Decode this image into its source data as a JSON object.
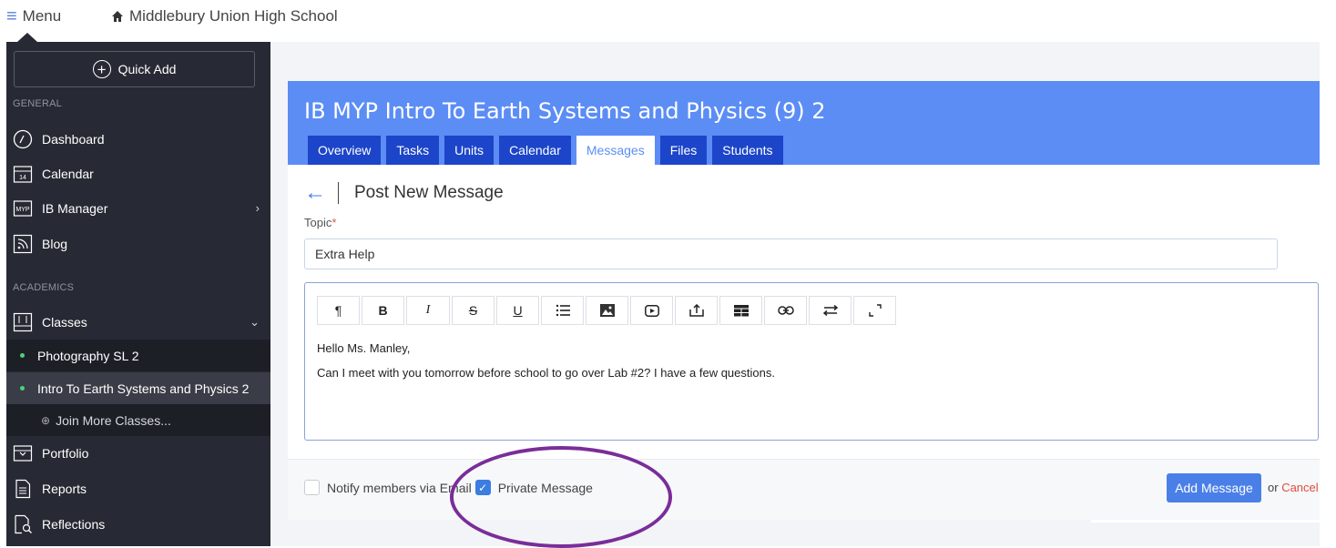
{
  "topbar": {
    "menu_label": "Menu",
    "school_name": "Middlebury Union High School"
  },
  "sidebar": {
    "quick_add_label": "Quick Add",
    "general_label": "GENERAL",
    "academics_label": "ACADEMICS",
    "items": [
      {
        "label": "Dashboard",
        "icon": "dashboard-icon"
      },
      {
        "label": "Calendar",
        "icon": "calendar-icon"
      },
      {
        "label": "IB Manager",
        "icon": "myp-icon"
      },
      {
        "label": "Blog",
        "icon": "blog-icon"
      },
      {
        "label": "Classes",
        "icon": "classes-icon"
      },
      {
        "label": "Portfolio",
        "icon": "portfolio-icon"
      },
      {
        "label": "Reports",
        "icon": "reports-icon"
      },
      {
        "label": "Reflections",
        "icon": "reflections-icon"
      }
    ],
    "calendar_icon_number": "14",
    "myp_icon_text": "MYP",
    "classes": [
      {
        "label": "Photography SL 2"
      },
      {
        "label": "Intro To Earth Systems and Physics 2"
      }
    ],
    "join_label": "Join More Classes..."
  },
  "course": {
    "title": "IB MYP Intro To Earth Systems and Physics (9) 2",
    "tabs": [
      "Overview",
      "Tasks",
      "Units",
      "Calendar",
      "Messages",
      "Files",
      "Students"
    ],
    "active_tab": "Messages"
  },
  "post": {
    "title": "Post New Message",
    "topic_label": "Topic",
    "topic_value": "Extra Help",
    "toolbar": [
      "paragraph-icon",
      "bold-icon",
      "italic-icon",
      "strikethrough-icon",
      "underline-icon",
      "list-icon",
      "image-icon",
      "video-icon",
      "upload-icon",
      "table-icon",
      "link-icon",
      "direction-icon",
      "fullscreen-icon"
    ],
    "message_line1": "Hello Ms. Manley,",
    "message_line2": "Can I meet with you tomorrow before school to go over Lab #2?  I have a few questions."
  },
  "footer": {
    "notify_label": "Notify members via Email",
    "notify_checked": false,
    "private_label": "Private Message",
    "private_checked": true,
    "add_button": "Add Message",
    "or_text": "or",
    "cancel_label": "Cancel"
  },
  "colors": {
    "sidebar_bg": "#272a34",
    "banner_bg": "#5b8df5",
    "tab_bg": "#1c45c9",
    "primary_button": "#4a7fe8",
    "annotation_ring": "#7a2d9a",
    "cancel_link": "#e04b3b"
  }
}
